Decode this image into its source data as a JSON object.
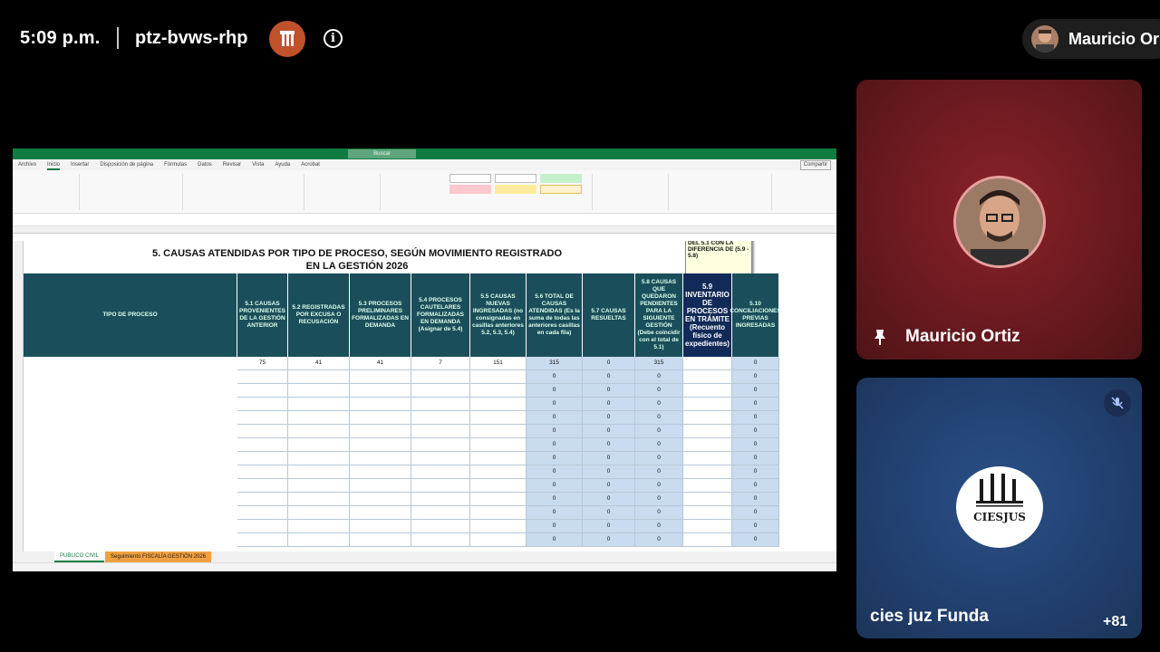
{
  "topbar": {
    "time": "5:09 p.m.",
    "meeting_code": "ptz-bvws-rhp",
    "user_chip_name": "Mauricio Or"
  },
  "spreadsheet": {
    "title": "5. CAUSAS ATENDIDAS POR TIPO DE PROCESO, SEGÚN MOVIMIENTO REGISTRADO",
    "subtitle": "EN LA GESTIÓN 2026",
    "note": "DEL 5.1 CON LA DIFERENCIA DE (5.9 - 5.8)",
    "ribbon_tabs": [
      "Archivo",
      "Inicio",
      "Insertar",
      "Disposición de página",
      "Fórmulas",
      "Datos",
      "Revisar",
      "Vista",
      "Ayuda",
      "Acrobat"
    ],
    "share_label": "Compartir",
    "search_label": "Buscar",
    "headers": {
      "tipo": "TIPO DE PROCESO",
      "h51": "5.1 CAUSAS PROVENIENTES DE LA GESTIÓN ANTERIOR",
      "h52": "5.2 REGISTRADAS POR EXCUSA O RECUSACIÓN",
      "h53": "5.3 PROCESOS PRELIMINARES FORMALIZADAS EN DEMANDA",
      "h54": "5.4 PROCESOS CAUTELARES FORMALIZADAS EN DEMANDA (Asignar de 5.4)",
      "h55": "5.5 CAUSAS NUEVAS INGRESADAS (no consignadas en casillas anteriores 5.2, 5.3, 5.4)",
      "h56": "5.6 TOTAL DE CAUSAS ATENDIDAS (Es la suma de todas las anteriores casillas en cada fila)",
      "h57": "5.7 CAUSAS RESUELTAS",
      "h58": "5.8 CAUSAS QUE QUEDARON PENDIENTES PARA LA SIGUIENTE GESTIÓN (Debe coincidir con el total de 5.1)",
      "h59": "5.9 INVENTARIO DE PROCESOS EN TRÁMITE (Recuento físico de expedientes)",
      "h510": "5.10 CONCILIACIONES PREVIAS INGRESADAS"
    },
    "first_row": {
      "c51": "75",
      "c52": "41",
      "c53": "41",
      "c54": "7",
      "c55": "151",
      "c56": "315",
      "c57": "0",
      "c58": "315",
      "c510": "0"
    },
    "zero": "0",
    "sheet_tabs": [
      "PUBLICO CIVIL",
      "Seguimiento FISCALÍA GESTIÓN 2026"
    ]
  },
  "participants": [
    {
      "name": "Mauricio Ortiz",
      "pinned": true
    },
    {
      "name": "cies juz Funda",
      "muted": true,
      "logo_text": "CIESJUS"
    }
  ],
  "more_participants": "+81"
}
